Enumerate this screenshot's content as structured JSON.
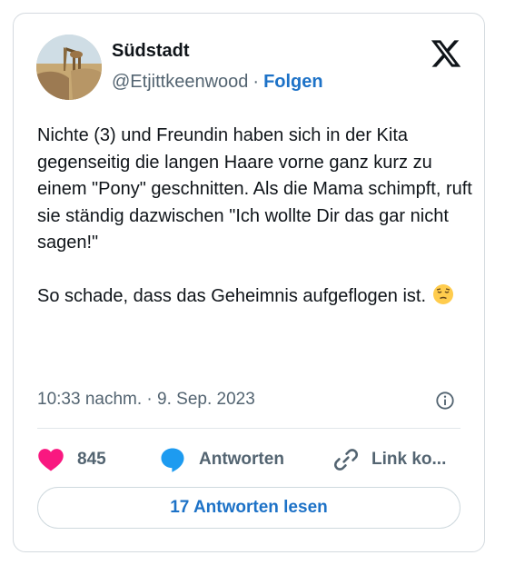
{
  "author": {
    "name": "Südstadt",
    "handle": "@Etjittkeenwood",
    "separator": "·",
    "follow_label": "Folgen"
  },
  "brand_icon": "x-logo-icon",
  "tweet": {
    "text": "Nichte (3) und Freundin haben sich in der Kita gegenseitig die langen Haare vorne ganz kurz zu einem \"Pony\" geschnitten. Als die Mama schimpft, ruft sie ständig dazwischen \"Ich wollte Dir das gar nicht sagen!\"\n\nSo schade, dass das Geheimnis aufgeflogen ist. ",
    "emoji": "pensive-face-emoji",
    "timestamp": "10:33 nachm. · 9. Sep. 2023"
  },
  "actions": {
    "like_icon": "heart-icon",
    "like_count": "845",
    "reply_icon": "reply-bubble-icon",
    "reply_label": "Antworten",
    "copy_icon": "link-icon",
    "copy_label": "Link ko..."
  },
  "read_replies_label": "17 Antworten lesen",
  "colors": {
    "accent": "#1d72c7",
    "like": "#f91880",
    "text": "#0f1419",
    "secondary": "#536471",
    "border": "#d4dadf"
  }
}
